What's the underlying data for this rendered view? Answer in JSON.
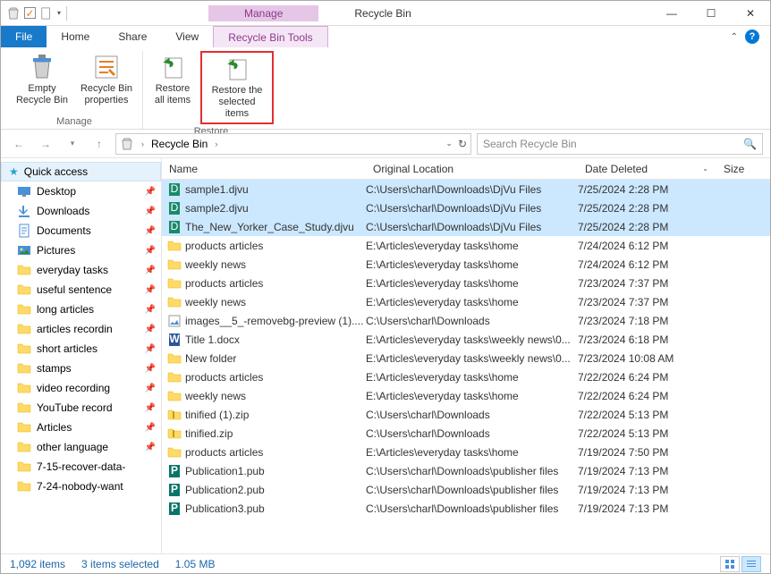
{
  "window": {
    "contextual_tab": "Manage",
    "title": "Recycle Bin"
  },
  "tabs": {
    "file": "File",
    "home": "Home",
    "share": "Share",
    "view": "View",
    "tools": "Recycle Bin Tools"
  },
  "ribbon": {
    "empty": "Empty Recycle Bin",
    "properties": "Recycle Bin properties",
    "group_manage": "Manage",
    "restore_all": "Restore all items",
    "restore_sel": "Restore the selected items",
    "group_restore": "Restore"
  },
  "address": {
    "location": "Recycle Bin",
    "search_placeholder": "Search Recycle Bin"
  },
  "sidebar": {
    "quick": "Quick access",
    "items": [
      {
        "label": "Desktop",
        "pin": true,
        "icon": "desktop"
      },
      {
        "label": "Downloads",
        "pin": true,
        "icon": "downloads"
      },
      {
        "label": "Documents",
        "pin": true,
        "icon": "documents"
      },
      {
        "label": "Pictures",
        "pin": true,
        "icon": "pictures"
      },
      {
        "label": "everyday tasks",
        "pin": true,
        "icon": "folder"
      },
      {
        "label": "useful sentence",
        "pin": true,
        "icon": "folder"
      },
      {
        "label": "long articles",
        "pin": true,
        "icon": "folder"
      },
      {
        "label": "articles recordin",
        "pin": true,
        "icon": "folder"
      },
      {
        "label": "short articles",
        "pin": true,
        "icon": "folder"
      },
      {
        "label": "stamps",
        "pin": true,
        "icon": "folder"
      },
      {
        "label": "video recording",
        "pin": true,
        "icon": "folder"
      },
      {
        "label": "YouTube record",
        "pin": true,
        "icon": "folder"
      },
      {
        "label": "Articles",
        "pin": true,
        "icon": "folder"
      },
      {
        "label": "other language",
        "pin": true,
        "icon": "folder"
      },
      {
        "label": "7-15-recover-data-",
        "pin": false,
        "icon": "folder"
      },
      {
        "label": "7-24-nobody-want",
        "pin": false,
        "icon": "folder"
      }
    ]
  },
  "columns": {
    "name": "Name",
    "location": "Original Location",
    "date": "Date Deleted",
    "size": "Size"
  },
  "files": [
    {
      "name": "sample1.djvu",
      "loc": "C:\\Users\\charl\\Downloads\\DjVu Files",
      "date": "7/25/2024 2:28 PM",
      "sel": true,
      "icon": "djvu"
    },
    {
      "name": "sample2.djvu",
      "loc": "C:\\Users\\charl\\Downloads\\DjVu Files",
      "date": "7/25/2024 2:28 PM",
      "sel": true,
      "icon": "djvu"
    },
    {
      "name": "The_New_Yorker_Case_Study.djvu",
      "loc": "C:\\Users\\charl\\Downloads\\DjVu Files",
      "date": "7/25/2024 2:28 PM",
      "sel": true,
      "icon": "djvu"
    },
    {
      "name": "products articles",
      "loc": "E:\\Articles\\everyday tasks\\home",
      "date": "7/24/2024 6:12 PM",
      "sel": false,
      "icon": "folder"
    },
    {
      "name": "weekly news",
      "loc": "E:\\Articles\\everyday tasks\\home",
      "date": "7/24/2024 6:12 PM",
      "sel": false,
      "icon": "folder"
    },
    {
      "name": "products articles",
      "loc": "E:\\Articles\\everyday tasks\\home",
      "date": "7/23/2024 7:37 PM",
      "sel": false,
      "icon": "folder"
    },
    {
      "name": "weekly news",
      "loc": "E:\\Articles\\everyday tasks\\home",
      "date": "7/23/2024 7:37 PM",
      "sel": false,
      "icon": "folder"
    },
    {
      "name": "images__5_-removebg-preview (1)....",
      "loc": "C:\\Users\\charl\\Downloads",
      "date": "7/23/2024 7:18 PM",
      "sel": false,
      "icon": "image"
    },
    {
      "name": "Title 1.docx",
      "loc": "E:\\Articles\\everyday tasks\\weekly news\\0...",
      "date": "7/23/2024 6:18 PM",
      "sel": false,
      "icon": "word"
    },
    {
      "name": "New folder",
      "loc": "E:\\Articles\\everyday tasks\\weekly news\\0...",
      "date": "7/23/2024 10:08 AM",
      "sel": false,
      "icon": "folder"
    },
    {
      "name": "products articles",
      "loc": "E:\\Articles\\everyday tasks\\home",
      "date": "7/22/2024 6:24 PM",
      "sel": false,
      "icon": "folder"
    },
    {
      "name": "weekly news",
      "loc": "E:\\Articles\\everyday tasks\\home",
      "date": "7/22/2024 6:24 PM",
      "sel": false,
      "icon": "folder"
    },
    {
      "name": "tinified (1).zip",
      "loc": "C:\\Users\\charl\\Downloads",
      "date": "7/22/2024 5:13 PM",
      "sel": false,
      "icon": "zip"
    },
    {
      "name": "tinified.zip",
      "loc": "C:\\Users\\charl\\Downloads",
      "date": "7/22/2024 5:13 PM",
      "sel": false,
      "icon": "zip"
    },
    {
      "name": "products articles",
      "loc": "E:\\Articles\\everyday tasks\\home",
      "date": "7/19/2024 7:50 PM",
      "sel": false,
      "icon": "folder"
    },
    {
      "name": "Publication1.pub",
      "loc": "C:\\Users\\charl\\Downloads\\publisher files",
      "date": "7/19/2024 7:13 PM",
      "sel": false,
      "icon": "pub"
    },
    {
      "name": "Publication2.pub",
      "loc": "C:\\Users\\charl\\Downloads\\publisher files",
      "date": "7/19/2024 7:13 PM",
      "sel": false,
      "icon": "pub"
    },
    {
      "name": "Publication3.pub",
      "loc": "C:\\Users\\charl\\Downloads\\publisher files",
      "date": "7/19/2024 7:13 PM",
      "sel": false,
      "icon": "pub"
    }
  ],
  "status": {
    "count": "1,092 items",
    "selected": "3 items selected",
    "size": "1.05 MB"
  }
}
